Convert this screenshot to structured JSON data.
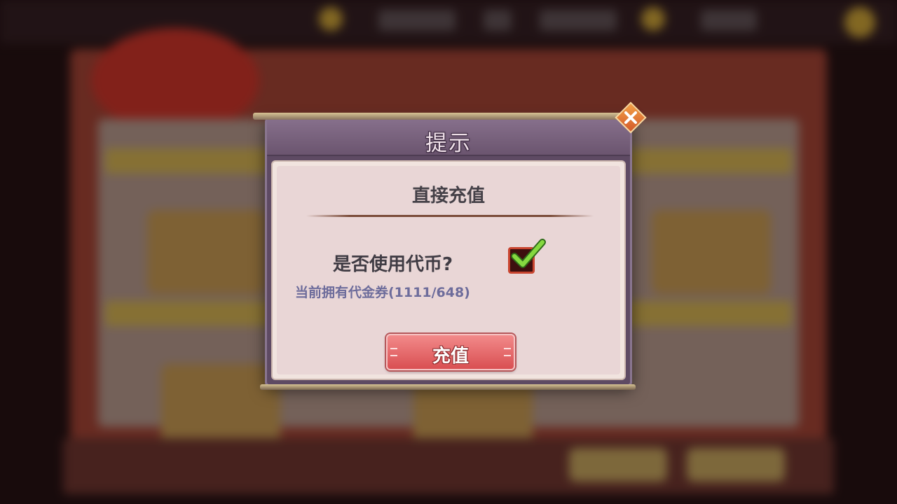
{
  "dialog": {
    "title": "提示",
    "subtitle": "直接充值",
    "question": "是否使用代币?",
    "use_tokens_checked": true,
    "tokens_line": "当前拥有代金券(1111/648)",
    "confirm_label": "充值"
  },
  "icons": {
    "close": "close-icon",
    "check": "checkmark-icon"
  },
  "colors": {
    "title_bar": "#6b556f",
    "content_bg": "#e9d6d6",
    "button": "#d94f52",
    "check": "#7cd33a",
    "close": "#d35a2a"
  }
}
